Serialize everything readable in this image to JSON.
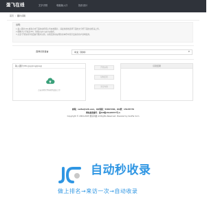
{
  "header": {
    "logo": "蛋飞在线",
    "nav": [
      "文字识别",
      "电脑版入口",
      "找页设计"
    ]
  },
  "breadcrumb": {
    "home": "首页",
    "separator": "/",
    "current": "图片识别"
  },
  "notice": {
    "title": "说明：",
    "lines": [
      "1.输入图片URL或者点击下面的虚框把上传本地图片，请最重视地选择下面的文字框下面的虚框来上传。",
      "2.图像大小不超过3M，支持jpg/png/jpeg格式。",
      "3.点击\"开始识别\"按钮进行图片识别，识别结果在右侧的文本框中显示出来供用户复制使用。"
    ]
  },
  "language": {
    "label": "选择识别语言",
    "selected": "中文（简体）",
    "caret": "▼"
  },
  "upload": {
    "label": "输入图片URL(jpg/png/jpeg)",
    "hint": "点击或将文件拖拽到此处上传"
  },
  "buttons": {
    "recognize": "开始识别",
    "copy": "复制结果",
    "clear": "清空内容"
  },
  "result": {
    "label": "识别结果"
  },
  "footer": {
    "line1": "邮箱：xeifei@126.com，QQ客服：54897290，QQ群：15145770",
    "line2": "网站备案编号：蛋ICP备15193577号-1",
    "line3": "Copyright © 2004-2025 浙东科技 All Rights Reserved. Powered by XenFei Corn"
  },
  "watermark": {
    "title": "自动秒收录",
    "subtitle": "做上排名→来访一次→自动收录"
  },
  "colors": {
    "topbar": "#2f333a",
    "upload_icon": "#3aa07a",
    "watermark": "#2f96e3"
  }
}
